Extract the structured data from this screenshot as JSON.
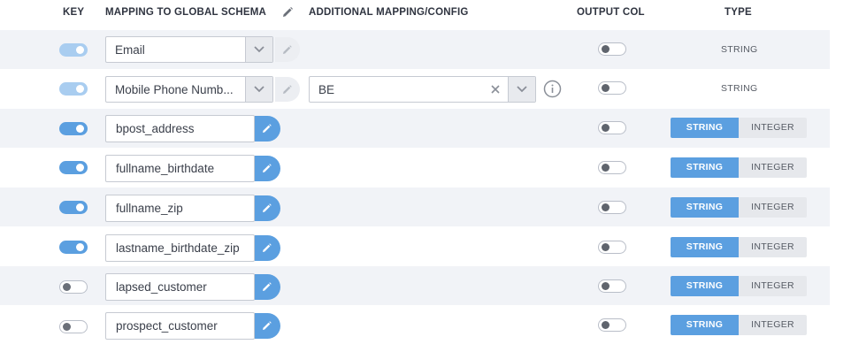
{
  "header": {
    "key": "KEY",
    "mapping": "MAPPING TO GLOBAL SCHEMA",
    "additional": "ADDITIONAL MAPPING/CONFIG",
    "output": "OUTPUT COL",
    "type": "TYPE"
  },
  "rows": [
    {
      "key": "on-disabled",
      "mapping": "Email",
      "type": "STRING"
    },
    {
      "key": "on-disabled",
      "mapping": "Mobile Phone Numb...",
      "config": "BE",
      "type": "STRING"
    },
    {
      "key": "on",
      "mapping": "bpost_address",
      "type_options": [
        "STRING",
        "INTEGER"
      ]
    },
    {
      "key": "on",
      "mapping": "fullname_birthdate",
      "type_options": [
        "STRING",
        "INTEGER"
      ]
    },
    {
      "key": "on",
      "mapping": "fullname_zip",
      "type_options": [
        "STRING",
        "INTEGER"
      ]
    },
    {
      "key": "on",
      "mapping": "lastname_birthdate_zip",
      "type_options": [
        "STRING",
        "INTEGER"
      ]
    },
    {
      "key": "off",
      "mapping": "lapsed_customer",
      "type_options": [
        "STRING",
        "INTEGER"
      ]
    },
    {
      "key": "off",
      "mapping": "prospect_customer",
      "type_options": [
        "STRING",
        "INTEGER"
      ]
    }
  ],
  "output_col": [
    "off",
    "off",
    "off",
    "off",
    "off",
    "off",
    "off",
    "off"
  ],
  "selected_type": "STRING",
  "colors": {
    "accent": "#5b9fe0",
    "row_alt": "#f1f3f7"
  },
  "icons": {
    "edit": "pencil-icon",
    "dropdown": "chevron-down-icon",
    "clear": "close-icon",
    "info": "info-icon"
  }
}
